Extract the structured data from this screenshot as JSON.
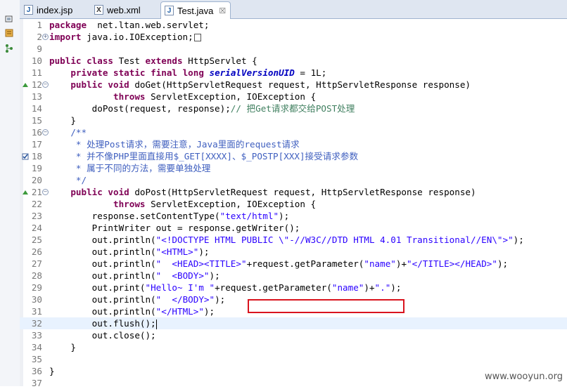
{
  "tabs": [
    {
      "label": "index.jsp",
      "icon": "jsp-file-icon",
      "active": false
    },
    {
      "label": "web.xml",
      "icon": "xml-file-icon",
      "active": false
    },
    {
      "label": "Test.java",
      "icon": "java-file-icon",
      "active": true,
      "close": "☒"
    }
  ],
  "lines": [
    {
      "n": "1",
      "segs": [
        [
          "kw",
          "package"
        ],
        [
          "",
          "  net.ltan.web.servlet;"
        ]
      ]
    },
    {
      "n": "2",
      "fold": "+",
      "segs": [
        [
          "kw",
          "import"
        ],
        [
          "",
          " java.io.IOException;"
        ]
      ],
      "box": true
    },
    {
      "n": "9",
      "segs": []
    },
    {
      "n": "10",
      "segs": [
        [
          "kw",
          "public class"
        ],
        [
          "",
          " Test "
        ],
        [
          "kw",
          "extends"
        ],
        [
          "",
          " HttpServlet {"
        ]
      ]
    },
    {
      "n": "11",
      "segs": [
        [
          "",
          "    "
        ],
        [
          "kw",
          "private static final long"
        ],
        [
          "",
          " "
        ],
        [
          "fld",
          "serialVersionUID"
        ],
        [
          "",
          " = 1L;"
        ]
      ]
    },
    {
      "n": "12",
      "fold": "-",
      "mark": "override",
      "segs": [
        [
          "",
          "    "
        ],
        [
          "kw",
          "public void"
        ],
        [
          "",
          " doGet(HttpServletRequest request, HttpServletResponse response)"
        ]
      ]
    },
    {
      "n": "13",
      "segs": [
        [
          "",
          "            "
        ],
        [
          "kw",
          "throws"
        ],
        [
          "",
          " ServletException, IOException {"
        ]
      ]
    },
    {
      "n": "14",
      "segs": [
        [
          "",
          "        doPost(request, response);"
        ],
        [
          "cmt",
          "// 把Get请求都交给POST处理"
        ]
      ]
    },
    {
      "n": "15",
      "segs": [
        [
          "",
          "    }"
        ]
      ]
    },
    {
      "n": "16",
      "fold": "-",
      "segs": [
        [
          "",
          "    "
        ],
        [
          "doc",
          "/**"
        ]
      ]
    },
    {
      "n": "17",
      "segs": [
        [
          "doc",
          "     * 处理Post请求，需要注意，Java里面的request请求"
        ]
      ]
    },
    {
      "n": "18",
      "mark": "task",
      "segs": [
        [
          "doc",
          "     * 并不像PHP里面直接用$_GET[XXXX]、$_POSTP[XXX]接受请求参数"
        ]
      ]
    },
    {
      "n": "19",
      "segs": [
        [
          "doc",
          "     * 属于不同的方法，需要单独处理"
        ]
      ]
    },
    {
      "n": "20",
      "segs": [
        [
          "doc",
          "     */"
        ]
      ]
    },
    {
      "n": "21",
      "fold": "-",
      "mark": "override",
      "segs": [
        [
          "",
          "    "
        ],
        [
          "kw",
          "public void"
        ],
        [
          "",
          " doPost(HttpServletRequest request, HttpServletResponse response)"
        ]
      ]
    },
    {
      "n": "22",
      "segs": [
        [
          "",
          "            "
        ],
        [
          "kw",
          "throws"
        ],
        [
          "",
          " ServletException, IOException {"
        ]
      ]
    },
    {
      "n": "23",
      "segs": [
        [
          "",
          "        response.setContentType("
        ],
        [
          "str",
          "\"text/html\""
        ],
        [
          "",
          ");"
        ]
      ]
    },
    {
      "n": "24",
      "segs": [
        [
          "",
          "        PrintWriter out = response.getWriter();"
        ]
      ]
    },
    {
      "n": "25",
      "segs": [
        [
          "",
          "        out.println("
        ],
        [
          "str",
          "\"<!DOCTYPE HTML PUBLIC \\\"-//W3C//DTD HTML 4.01 Transitional//EN\\\">\""
        ],
        [
          "",
          ");"
        ]
      ]
    },
    {
      "n": "26",
      "segs": [
        [
          "",
          "        out.println("
        ],
        [
          "str",
          "\"<HTML>\""
        ],
        [
          "",
          ");"
        ]
      ]
    },
    {
      "n": "27",
      "segs": [
        [
          "",
          "        out.println("
        ],
        [
          "str",
          "\"  <HEAD><TITLE>\""
        ],
        [
          "",
          "+request.getParameter("
        ],
        [
          "str",
          "\"name\""
        ],
        [
          "",
          ")+"
        ],
        [
          "str",
          "\"</TITLE></HEAD>\""
        ],
        [
          "",
          ");"
        ]
      ]
    },
    {
      "n": "28",
      "segs": [
        [
          "",
          "        out.println("
        ],
        [
          "str",
          "\"  <BODY>\""
        ],
        [
          "",
          ");"
        ]
      ]
    },
    {
      "n": "29",
      "segs": [
        [
          "",
          "        out.print("
        ],
        [
          "str",
          "\"Hello~ I'm \""
        ],
        [
          "",
          "+request.getParameter("
        ],
        [
          "str",
          "\"name\""
        ],
        [
          "",
          ")+"
        ],
        [
          "str",
          "\".\""
        ],
        [
          "",
          ");"
        ]
      ]
    },
    {
      "n": "30",
      "segs": [
        [
          "",
          "        out.println("
        ],
        [
          "str",
          "\"  </BODY>\""
        ],
        [
          "",
          ");"
        ]
      ]
    },
    {
      "n": "31",
      "segs": [
        [
          "",
          "        out.println("
        ],
        [
          "str",
          "\"</HTML>\""
        ],
        [
          "",
          ");"
        ]
      ]
    },
    {
      "n": "32",
      "current": true,
      "segs": [
        [
          "",
          "        out.flush();"
        ]
      ],
      "caret": true
    },
    {
      "n": "33",
      "segs": [
        [
          "",
          "        out.close();"
        ]
      ]
    },
    {
      "n": "34",
      "segs": [
        [
          "",
          "    }"
        ]
      ]
    },
    {
      "n": "35",
      "segs": []
    },
    {
      "n": "36",
      "segs": [
        [
          "",
          "}"
        ]
      ]
    },
    {
      "n": "37",
      "segs": []
    }
  ],
  "watermark": "www.wooyun.org",
  "colors": {
    "keyword": "#7f0055",
    "string": "#2a00ff",
    "comment": "#3f7f5f",
    "javadoc": "#3f5fbf",
    "field": "#0000c0",
    "highlight": "#d9141e"
  }
}
